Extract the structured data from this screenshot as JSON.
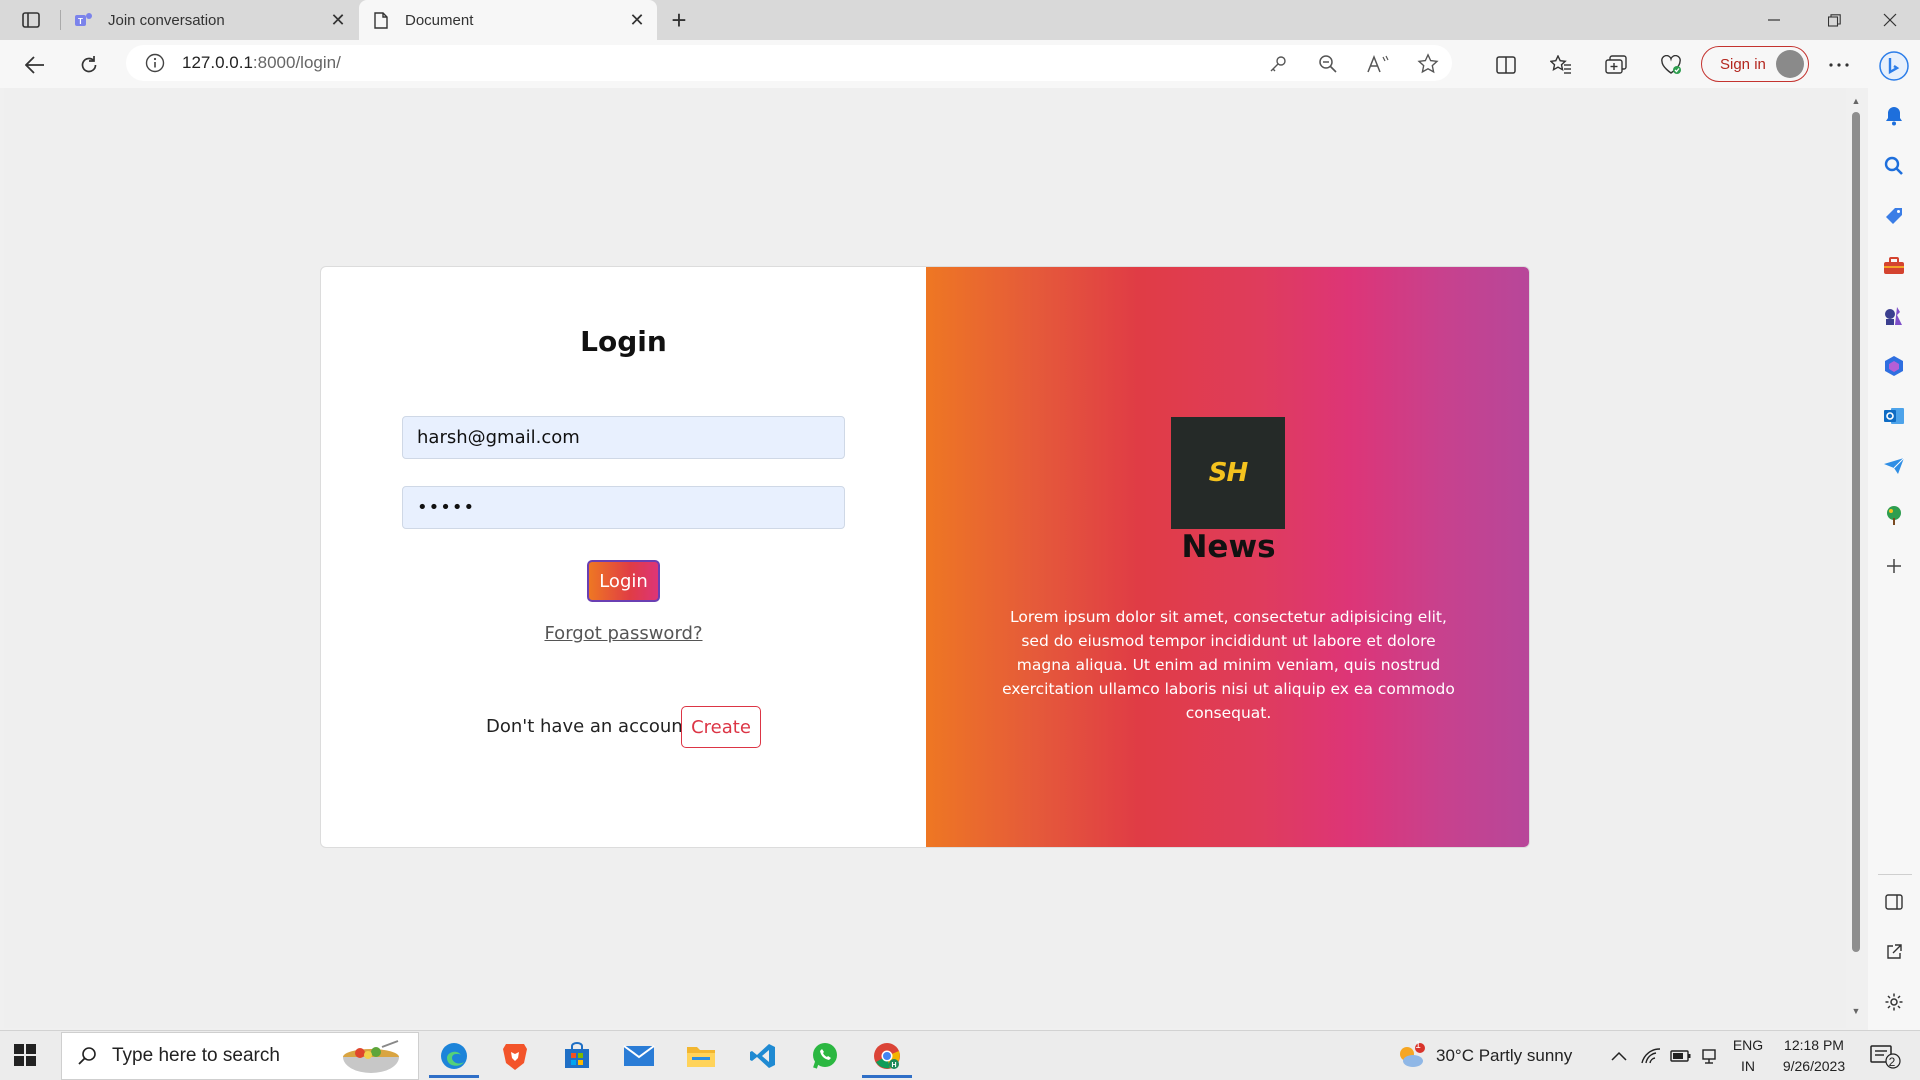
{
  "browser": {
    "tabs": [
      {
        "title": "Join conversation",
        "active": false
      },
      {
        "title": "Document",
        "active": true
      }
    ],
    "url_host": "127.0.0.1",
    "url_path": ":8000/login/",
    "sign_in_label": "Sign in"
  },
  "page": {
    "login_title": "Login",
    "email_value": "harsh@gmail.com",
    "password_mask": "•••••",
    "login_button": "Login",
    "forgot_link": "Forgot password?",
    "no_account_text": "Don't have an account?",
    "create_button": "Create",
    "logo_text": "SH",
    "news_title": "News",
    "news_body": "Lorem ipsum dolor sit amet, consectetur adipisicing elit, sed do eiusmod tempor incididunt ut labore et dolore magna aliqua. Ut enim ad minim veniam, quis nostrud exercitation ullamco laboris nisi ut aliquip ex ea commodo consequat."
  },
  "taskbar": {
    "search_placeholder": "Type here to search",
    "weather": "30°C  Partly sunny",
    "weather_badge": "1",
    "lang_top": "ENG",
    "lang_bottom": "IN",
    "time": "12:18 PM",
    "date": "9/26/2023",
    "notif_count": "2"
  },
  "colors": {
    "gradient_start": "#ee7723",
    "gradient_mid": "#e03c45",
    "gradient_end": "#b7479a",
    "create_red": "#dc3545",
    "input_bg": "#e8f0fe"
  }
}
